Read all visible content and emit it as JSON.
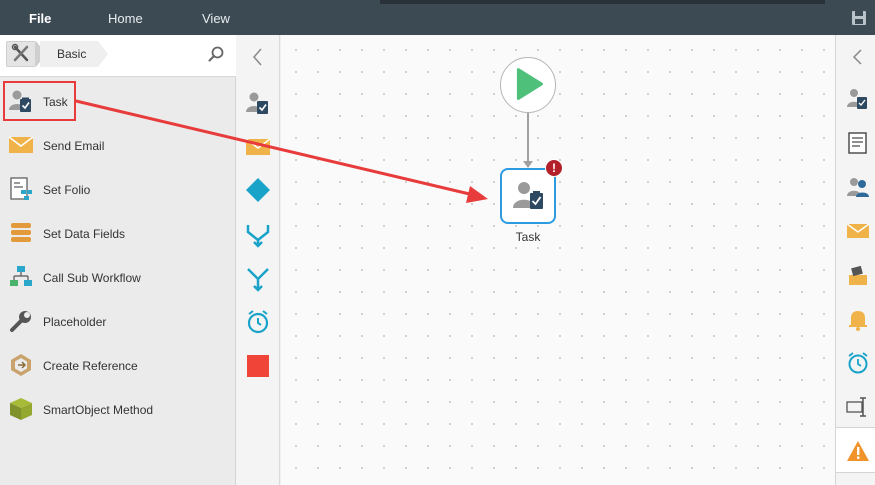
{
  "menu": {
    "file": "File",
    "home": "Home",
    "view": "View"
  },
  "toolbox": {
    "breadcrumb": "Basic",
    "items": [
      {
        "label": "Task",
        "icon": "task-icon"
      },
      {
        "label": "Send Email",
        "icon": "email-icon"
      },
      {
        "label": "Set Folio",
        "icon": "folio-icon"
      },
      {
        "label": "Set Data Fields",
        "icon": "data-fields-icon"
      },
      {
        "label": "Call Sub Workflow",
        "icon": "sub-workflow-icon"
      },
      {
        "label": "Placeholder",
        "icon": "wrench-icon"
      },
      {
        "label": "Create Reference",
        "icon": "reference-icon"
      },
      {
        "label": "SmartObject Method",
        "icon": "smartobject-icon"
      }
    ]
  },
  "canvas": {
    "task_label": "Task",
    "error_glyph": "!"
  },
  "colors": {
    "accent_blue": "#2d9be0",
    "start_green": "#4ec07a",
    "highlight_red": "#e83c3c",
    "error_red": "#b3202a",
    "email_orange": "#f0b34a",
    "diamond_teal": "#1aa3c9",
    "stop_red": "#f04438"
  }
}
